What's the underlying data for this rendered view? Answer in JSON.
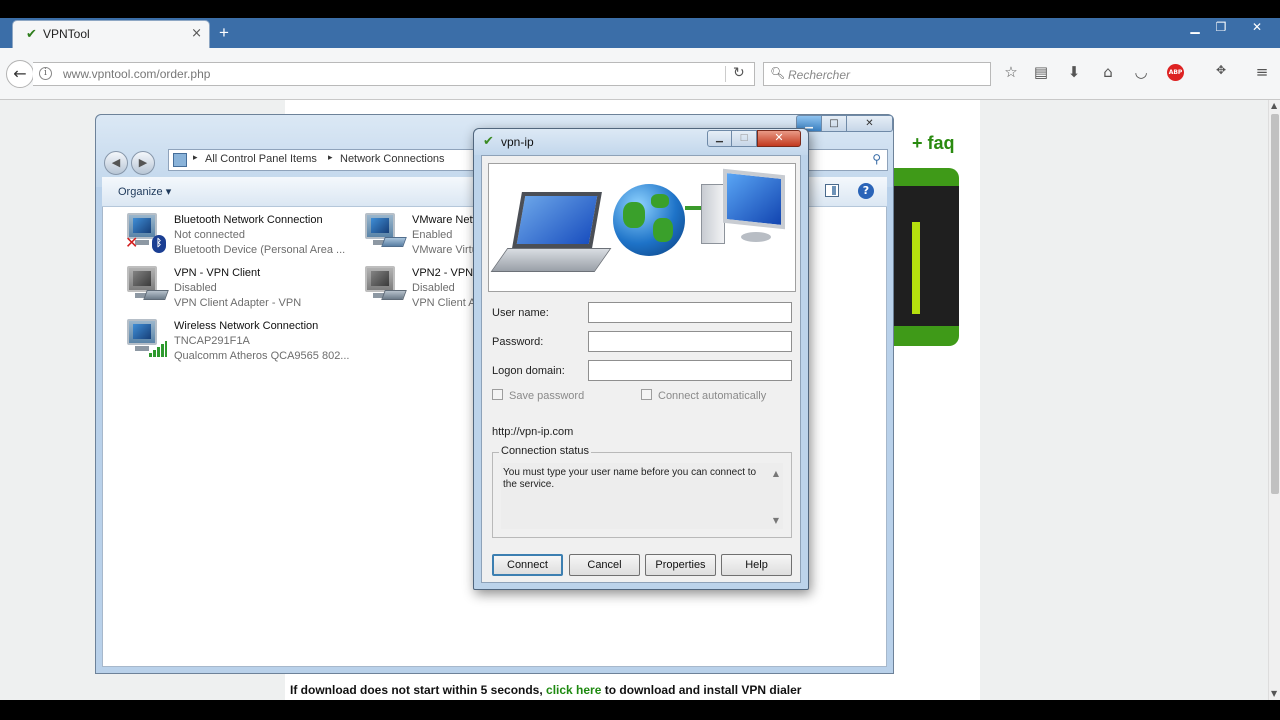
{
  "browser": {
    "tab_title": "VPNTool",
    "tab_close": "×",
    "new_tab": "+",
    "url": "www.vpntool.com/order.php",
    "search_placeholder": "Rechercher",
    "window_controls": {
      "minimize": "▁",
      "restore": "❐",
      "close": "✕"
    }
  },
  "webpage": {
    "faq_link": "+ faq",
    "download_note_prefix": "If download does not start within 5 seconds,",
    "download_link": "click here",
    "download_note_suffix": "to download and install VPN dialer"
  },
  "explorer": {
    "breadcrumb": [
      "All Control Panel Items",
      "Network Connections"
    ],
    "organize_label": "Organize",
    "connections": [
      {
        "name": "Bluetooth Network Connection",
        "status": "Not connected",
        "device": "Bluetooth Device (Personal Area ...",
        "icon": "bluetooth-network-icon"
      },
      {
        "name": "VMware Netw",
        "status": "Enabled",
        "device": "VMware Virtu",
        "icon": "vmware-network-icon"
      },
      {
        "name": "VPN - VPN Client",
        "status": "Disabled",
        "device": "VPN Client Adapter - VPN",
        "icon": "vpn-network-icon"
      },
      {
        "name": "VPN2 - VPN C",
        "status": "Disabled",
        "device": "VPN Client Ad",
        "icon": "vpn2-network-icon"
      },
      {
        "name": "Wireless Network Connection",
        "status": "TNCAP291F1A",
        "device": "Qualcomm Atheros QCA9565 802...",
        "icon": "wireless-network-icon"
      }
    ]
  },
  "dialog": {
    "title": "vpn-ip",
    "username_label": "User name:",
    "password_label": "Password:",
    "domain_label": "Logon domain:",
    "username_value": "",
    "password_value": "",
    "domain_value": "",
    "save_password_label": "Save password",
    "connect_auto_label": "Connect automatically",
    "url": "http://vpn-ip.com",
    "status_legend": "Connection status",
    "status_message": "You must type your user name before you can connect to the service.",
    "buttons": {
      "connect": "Connect",
      "cancel": "Cancel",
      "properties": "Properties",
      "help": "Help"
    }
  }
}
